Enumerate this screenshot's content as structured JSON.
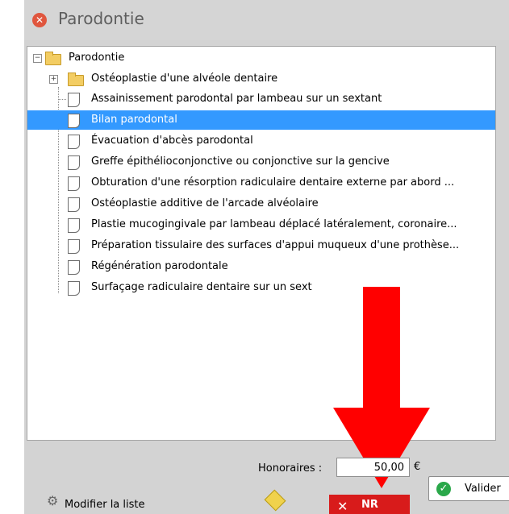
{
  "window": {
    "title": "Parodontie"
  },
  "tree": {
    "root_label": "Parodontie",
    "items": [
      {
        "label": "Ostéoplastie d'une alvéole dentaire",
        "type": "folder",
        "expanded": false
      },
      {
        "label": "Assainissement parodontal par lambeau sur un sextant",
        "type": "document"
      },
      {
        "label": "Bilan parodontal",
        "type": "document",
        "selected": true
      },
      {
        "label": "Évacuation d'abcès parodontal",
        "type": "document"
      },
      {
        "label": "Greffe épithélioconjonctive ou conjonctive sur la gencive",
        "type": "document"
      },
      {
        "label": "Obturation d'une résorption radiculaire dentaire externe par abord ...",
        "type": "document"
      },
      {
        "label": "Ostéoplastie additive de l'arcade alvéolaire",
        "type": "document"
      },
      {
        "label": "Plastie mucogingivale par lambeau déplacé latéralement, coronaire...",
        "type": "document"
      },
      {
        "label": "Préparation tissulaire des surfaces d'appui muqueux d'une prothèse...",
        "type": "document"
      },
      {
        "label": "Régénération parodontale",
        "type": "document"
      },
      {
        "label": "Surfaçage radiculaire dentaire sur un sext",
        "type": "document"
      }
    ]
  },
  "footer": {
    "fee_label": "Honoraires :",
    "fee_value": "50,00",
    "currency": "€",
    "validate_label": "Valider",
    "modify_list_label": "Modifier la liste",
    "nr_label": "NR"
  },
  "colors": {
    "selection": "#3399ff",
    "arrow": "#ff0000",
    "nr_background": "#d81b1b",
    "close_icon": "#e0563e"
  }
}
